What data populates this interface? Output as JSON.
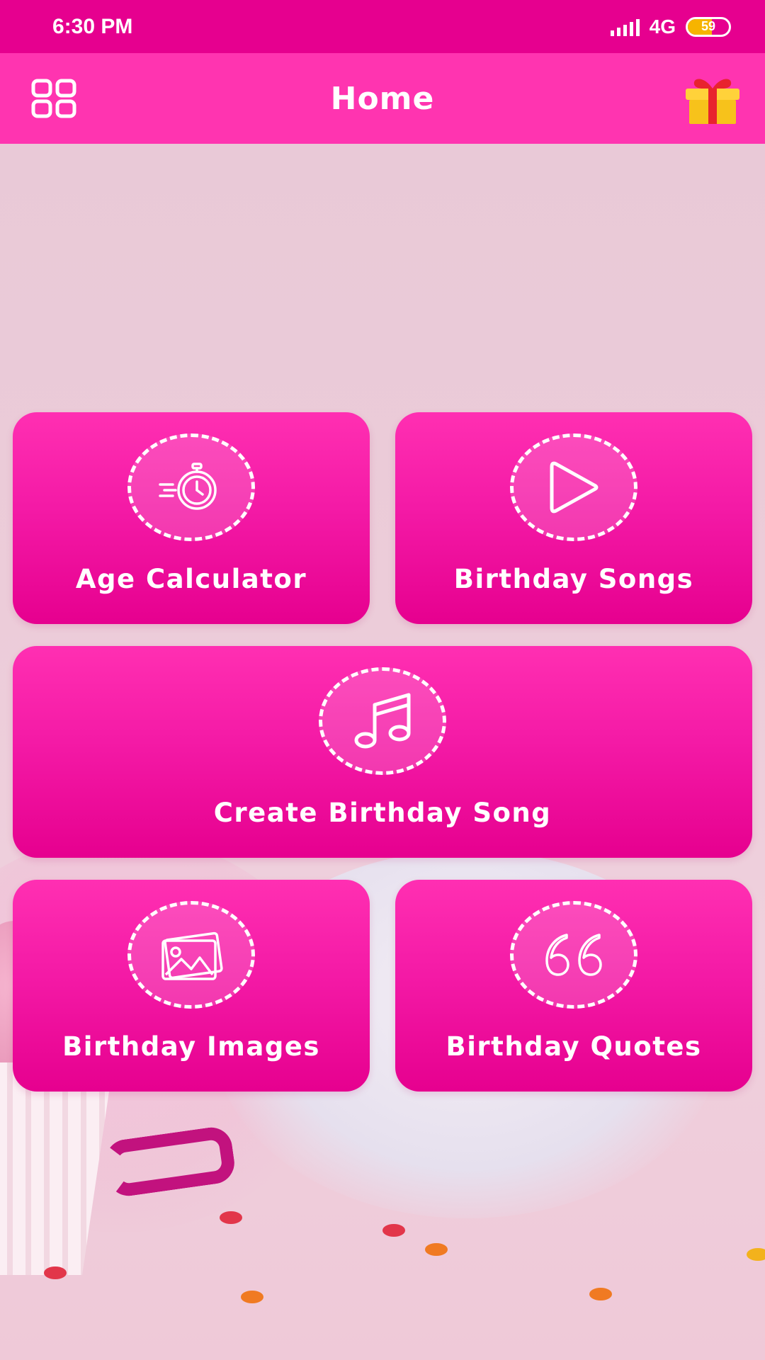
{
  "status_bar": {
    "time": "6:30 PM",
    "network": "4G",
    "battery_level": "59",
    "battery_fraction": 0.59
  },
  "app_bar": {
    "title": "Home",
    "menu_icon": "grid-menu-icon",
    "gift_icon": "gift-icon"
  },
  "colors": {
    "status_bar": "#e6008f",
    "app_bar": "#ff34b0",
    "card_top": "#ff2fb2",
    "card_bottom": "#e6008f"
  },
  "cards": [
    {
      "label": "Age Calculator",
      "icon": "stopwatch-icon"
    },
    {
      "label": "Birthday Songs",
      "icon": "play-icon"
    },
    {
      "label": "Create Birthday Song",
      "icon": "music-note-icon"
    },
    {
      "label": "Birthday Images",
      "icon": "image-gallery-icon"
    },
    {
      "label": "Birthday Quotes",
      "icon": "quote-icon"
    }
  ]
}
